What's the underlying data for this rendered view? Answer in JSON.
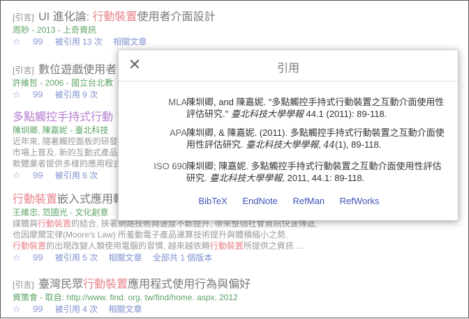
{
  "results": [
    {
      "tag": "[引言]",
      "title_pre": "UI 進化論: ",
      "title_hl": "行動裝置",
      "title_post": "使用者介面設計",
      "meta": "周眇 - 2013 - 上奇資訊",
      "cited": "被引用 13 次",
      "related": "相關文章"
    },
    {
      "tag": "[引言]",
      "title_pre": "數位遊戲使用者",
      "meta": "許維哲 - 2006 - 國立台北教",
      "cited": "被引用 9 次"
    },
    {
      "title_pre": "多點觸控手持式行動",
      "meta": "陳圳卿, 陳嘉妮 - 臺北科技",
      "snippet1": "近年來, 隨著觸控面板的研發",
      "snippet2": "市場上普及. 新的互動式產品",
      "snippet3": "軟體業者提供多樣的應用程式",
      "cited": "被引用 6 次"
    },
    {
      "title_hl": "行動裝置",
      "title_post": "嵌入式應用軟",
      "meta": "王維忠, 范國光 - 文化創意",
      "snippet1_pre": "媒體與",
      "snippet1_hl": "行動裝置",
      "snippet1_post": "的結合, 挾著網路技術與速度不斷提升, 帶來整個社會資訊快速傳遞,",
      "snippet2": "也因摩爾定律(Moore's Law) 所羞動電子產品運算技術提升與體積縮小之勢,",
      "snippet3_hl1": "行動裝置",
      "snippet3_mid": "的出現改變人類使用電腦的習慣, 越來越依賴",
      "snippet3_hl2": "行動裝置",
      "snippet3_post": "所提供之資訊 ...",
      "cited": "被引用 5 次",
      "related": "相關文章",
      "versions": "全部共 1 個版本"
    },
    {
      "tag": "[引言]",
      "title_pre": "臺灣民眾",
      "title_hl": "行動裝置",
      "title_post": "應用程式使用行為與偏好",
      "meta": "資策會 - 取自: http://www. find. org. tw/find/home. aspx, 2012",
      "cited": "被引用 4 次",
      "related": "相關文章"
    }
  ],
  "icons": {
    "star": "☆",
    "quote": "99"
  },
  "modal": {
    "title": "引用",
    "close": "✕",
    "mla_label": "MLA",
    "mla_text": "陳圳卿, and 陳嘉妮. \"多點觸控手持式行動裝置之互動介面使用性評估研究.\"",
    "mla_journal": "臺北科技大學學報",
    "mla_tail": " 44.1 (2011): 89-118.",
    "apa_label": "APA",
    "apa_text": "陳圳卿, & 陳嘉妮. (2011). 多點觸控手持式行動裝置之互動介面使用性評估研究.",
    "apa_journal": "臺北科技大學學報",
    "apa_vol": "44",
    "apa_tail": "(1), 89-118.",
    "iso_label": "ISO 690",
    "iso_text": "陳圳卿; 陳嘉妮. 多點觸控手持式行動裝置之互動介面使用性評估研究.",
    "iso_journal": "臺北科技大學學報",
    "iso_tail": ", 2011, 44.1: 89-118.",
    "formats": [
      "BibTeX",
      "EndNote",
      "RefMan",
      "RefWorks"
    ]
  }
}
